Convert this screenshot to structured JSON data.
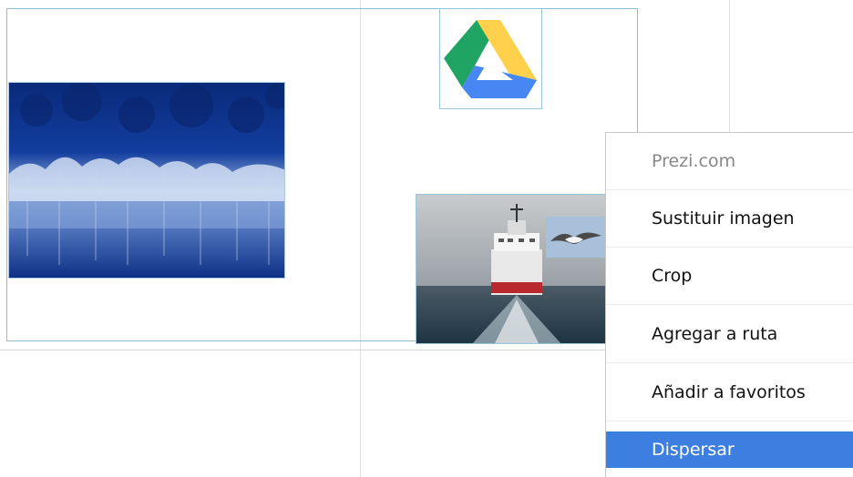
{
  "canvas": {
    "images": [
      {
        "name": "forest-image",
        "content": "snow-covered-forest"
      },
      {
        "name": "google-drive-logo",
        "content": "google-drive-icon"
      },
      {
        "name": "ship-image",
        "content": "ship-at-sea"
      },
      {
        "name": "seagull-image",
        "content": "seagull"
      }
    ]
  },
  "context_menu": {
    "header": "Prezi.com",
    "items": [
      {
        "label": "Sustituir imagen"
      },
      {
        "label": "Crop"
      },
      {
        "label": "Agregar a ruta"
      },
      {
        "label": "Añadir a favoritos"
      },
      {
        "label": "Dispersar",
        "highlighted": true
      }
    ],
    "highlight_color": "#3d7fe0"
  },
  "colors": {
    "drive_green": "#1fa463",
    "drive_yellow": "#ffd04b",
    "drive_blue": "#4687f4",
    "selection_border": "#8fbcd4"
  }
}
